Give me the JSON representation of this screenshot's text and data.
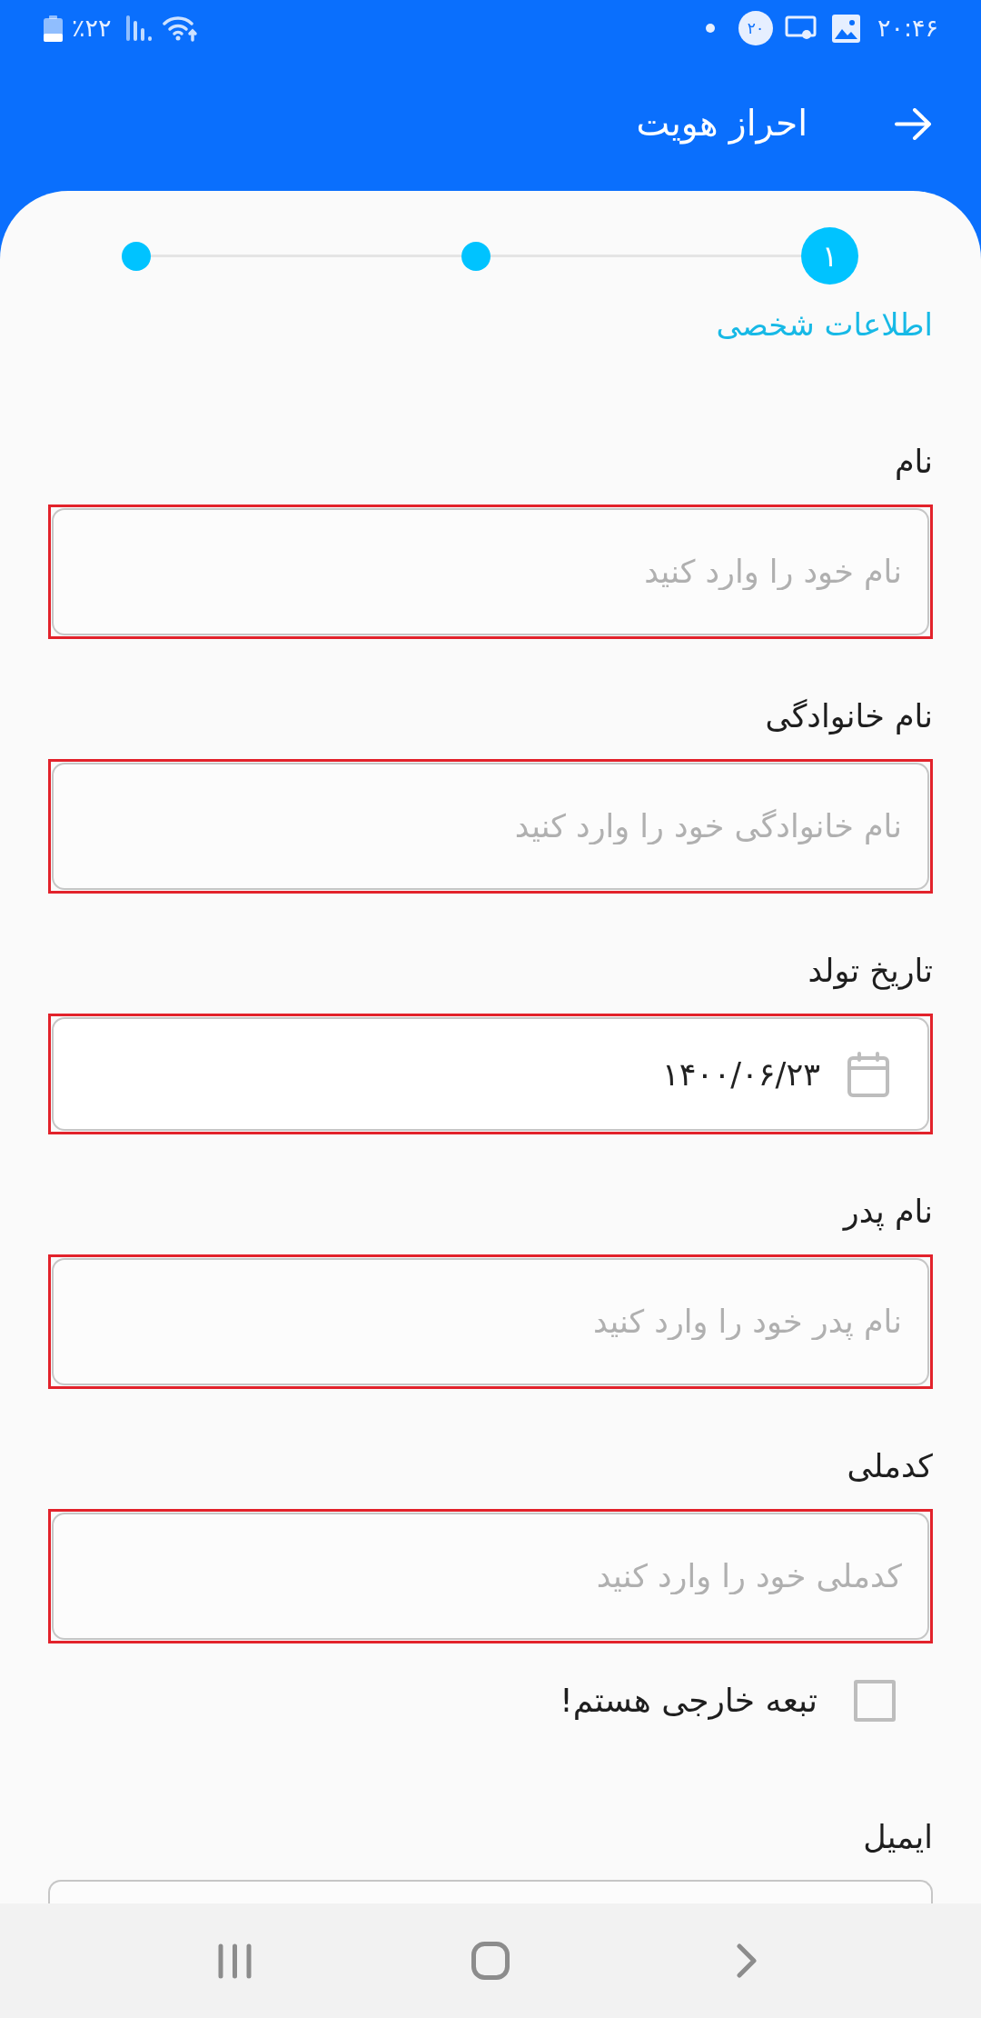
{
  "status_bar": {
    "time": "۲۰:۴۶",
    "notification_count": "۲۰",
    "battery_percent": "٪۲۲"
  },
  "header": {
    "title": "احراز هویت"
  },
  "stepper": {
    "steps": [
      {
        "number": "۱",
        "selected": true
      },
      {
        "selected": false
      },
      {
        "selected": false
      }
    ],
    "current_title": "اطلاعات شخصی"
  },
  "fields": [
    {
      "kind": "text",
      "label": "نام",
      "placeholder": "نام خود را وارد کنید",
      "highlighted": true
    },
    {
      "kind": "text",
      "label": "نام خانوادگی",
      "placeholder": "نام خانوادگی خود را وارد کنید",
      "highlighted": true
    },
    {
      "kind": "date",
      "label": "تاریخ تولد",
      "value": "۱۴۰۰/۰۶/۲۳",
      "highlighted": true
    },
    {
      "kind": "text",
      "label": "نام پدر",
      "placeholder": "نام پدر خود را وارد کنید",
      "highlighted": true
    },
    {
      "kind": "text",
      "label": "کدملی",
      "placeholder": "کدملی خود را وارد کنید",
      "highlighted": true
    },
    {
      "kind": "checkbox",
      "label": "تبعه خارجی هستم!",
      "checked": false
    },
    {
      "kind": "text",
      "label": "ایمیل",
      "highlighted": false
    }
  ]
}
